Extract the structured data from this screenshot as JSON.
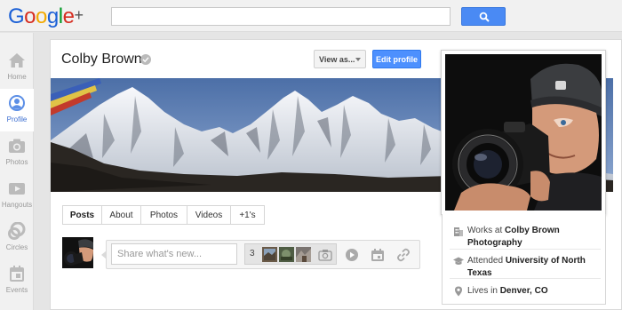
{
  "app": {
    "logo_text": "Google+"
  },
  "search": {
    "value": "",
    "placeholder": ""
  },
  "leftnav": {
    "items": [
      {
        "label": "Home",
        "icon": "home-icon"
      },
      {
        "label": "Profile",
        "icon": "profile-icon"
      },
      {
        "label": "Photos",
        "icon": "camera-icon"
      },
      {
        "label": "Hangouts",
        "icon": "video-icon"
      },
      {
        "label": "Circles",
        "icon": "circles-icon"
      },
      {
        "label": "Events",
        "icon": "calendar-icon"
      }
    ]
  },
  "profile": {
    "name": "Colby Brown",
    "view_as_label": "View as...",
    "edit_label": "Edit profile"
  },
  "tabs": [
    {
      "label": "Posts",
      "active": true
    },
    {
      "label": "About",
      "active": false
    },
    {
      "label": "Photos",
      "active": false
    },
    {
      "label": "Videos",
      "active": false
    },
    {
      "label": "+1's",
      "active": false
    }
  ],
  "share": {
    "placeholder": "Share what's new...",
    "photo_count": "3"
  },
  "about": {
    "work_prefix": "Works at ",
    "work_place": "Colby Brown Photography",
    "school_prefix": "Attended ",
    "school": "University of North Texas",
    "lives_prefix": "Lives in ",
    "lives": "Denver, CO"
  },
  "colors": {
    "accent_blue": "#4d90fe",
    "search_blue": "#4a8af4",
    "nav_active": "#3d6fd1"
  }
}
